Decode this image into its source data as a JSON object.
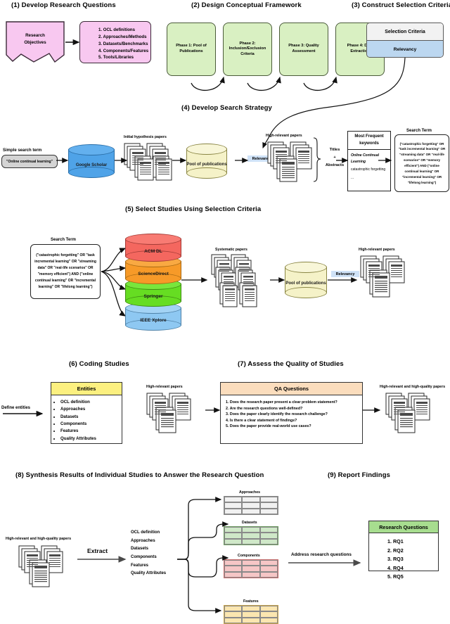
{
  "sections": [
    {
      "id": "s1",
      "title": "(1) Develop Research Questions"
    },
    {
      "id": "s2",
      "title": "(2) Design Conceptual Framework"
    },
    {
      "id": "s3",
      "title": "(3) Construct Selection Criteria"
    },
    {
      "id": "s4",
      "title": "(4) Develop Search Strategy"
    },
    {
      "id": "s5",
      "title": "(5) Select Studies Using Selection Criteria"
    },
    {
      "id": "s6",
      "title": "(6) Coding Studies"
    },
    {
      "id": "s7",
      "title": "(7) Assess the Quality of Studies"
    },
    {
      "id": "s8",
      "title": "(8) Synthesis Results of Individual Studies to Answer the Research Question"
    },
    {
      "id": "s9",
      "title": "(9) Report Findings"
    }
  ],
  "s1": {
    "objectives_label": "Research\nObjectives",
    "objectives_line1": "Research",
    "objectives_line2": "Objectives",
    "questions": [
      "1. OCL definitions",
      "2. Approaches/Methods",
      "3. Datasets/Benchmarks",
      "4. Components/Features",
      "5. Tools/Libraries"
    ]
  },
  "s2": {
    "phases": [
      "Phase 1: Pool of Publications",
      "Phase 2: Inclusion/Exclusion Criteria",
      "Phase 3: Quality Assessment",
      "Phase 4: Data Extraction"
    ]
  },
  "s3": {
    "table_header": "Selection Criteria",
    "table_row": "Relevancy",
    "header_color": "#f2f2f2",
    "row_color": "#bcd7f0"
  },
  "s4": {
    "simple_search_label": "Simple search term",
    "simple_search_value": "\"Online continual learning\"",
    "engine": "Google Scholar",
    "engine_color": "#4fa3e8",
    "initial_papers_label": "Initial hypothesis papers",
    "pool_label": "Pool of publications",
    "pool_color": "#f5f2c8",
    "relevancy_label": "Relevancy",
    "high_relevant_label": "High-relevant papers",
    "titles_abstracts": "Titles\n+\nAbstracts",
    "titles_line1": "Titles",
    "titles_line2": "+",
    "titles_line3": "Abstracts",
    "keywords_title_line1": "Most Frequent",
    "keywords_title_line2": "keywords",
    "keywords": [
      "Online Continual Learning",
      "catastrophic forgetting",
      "..."
    ],
    "search_term_label": "Search Term",
    "search_term_value": "(\"catastrophic forgetting\" OR \"task incremental learning\" OR \"streaming data\" OR \"real-life scenarios\" OR \"memory efficient\") AND (\"online continual learning\" OR \"incremental learning\" OR \"lifelong learning\")"
  },
  "s5": {
    "search_term_label": "Search Term",
    "search_term_value": "(\"catastrophic forgetting\" OR \"task incremental learning\" OR \"streaming data\" OR \"real-life scenarios\" OR \"memory efficient\") AND (\"online continual learning\" OR \"incremental learning\" OR \"lifelong learning\")",
    "databases": [
      {
        "name": "ACM DL",
        "color": "#f4675f"
      },
      {
        "name": "ScienceDirect",
        "color": "#f79a28"
      },
      {
        "name": "Springer",
        "color": "#66dd22"
      },
      {
        "name": "IEEE Xplore",
        "color": "#8ec8f2"
      }
    ],
    "systematic_label": "Systematic papers",
    "pool_label": "Pool of publications",
    "relevancy_label": "Relevancy",
    "high_relevant_label": "High-relevant papers"
  },
  "s6": {
    "define_entities": "Define entities",
    "entities_title": "Entities",
    "entities_header_color": "#fcf080",
    "entities": [
      "OCL definition",
      "Approaches",
      "Datasets",
      "Components",
      "Features",
      "Quality Attributes"
    ]
  },
  "s7": {
    "input_label": "High-relevant papers",
    "qa_title": "QA Questions",
    "qa_header_color": "#fbddbd",
    "questions": [
      "1. Does the research paper present a clear problem statement?",
      "2. Are the research questions well-defined?",
      "3. Does the paper clearly identify the research challenge?",
      "4. Is there a clear statement of findings?",
      "5. Does the paper provide real-world use cases?"
    ],
    "output_label": "High-relevant and high-quality papers"
  },
  "s8": {
    "papers_label": "High-relevant and high-quality papers",
    "extract_label": "Extract",
    "extract_items": [
      "OCL definition",
      "Approaches",
      "Datasets",
      "Components",
      "Features",
      "Quality Attributes"
    ],
    "tables": [
      {
        "label": "Approaches",
        "color": "#f1f1f1",
        "border": "#8a8a8a"
      },
      {
        "label": "Datasets",
        "color": "#cfe8c8",
        "border": "#6c9c60"
      },
      {
        "label": "Components",
        "color": "#f6c6c6",
        "border": "#c96a6a"
      },
      {
        "label": "Features",
        "color": "#fbe6b0",
        "border": "#c9a44a"
      }
    ],
    "address_label": "Address research questions"
  },
  "s9": {
    "title": "Research Questions",
    "header_color": "#a7dd8f",
    "items": [
      "1. RQ1",
      "2. RQ2",
      "3. RQ3",
      "4. RQ4",
      "5. RQ5"
    ]
  }
}
